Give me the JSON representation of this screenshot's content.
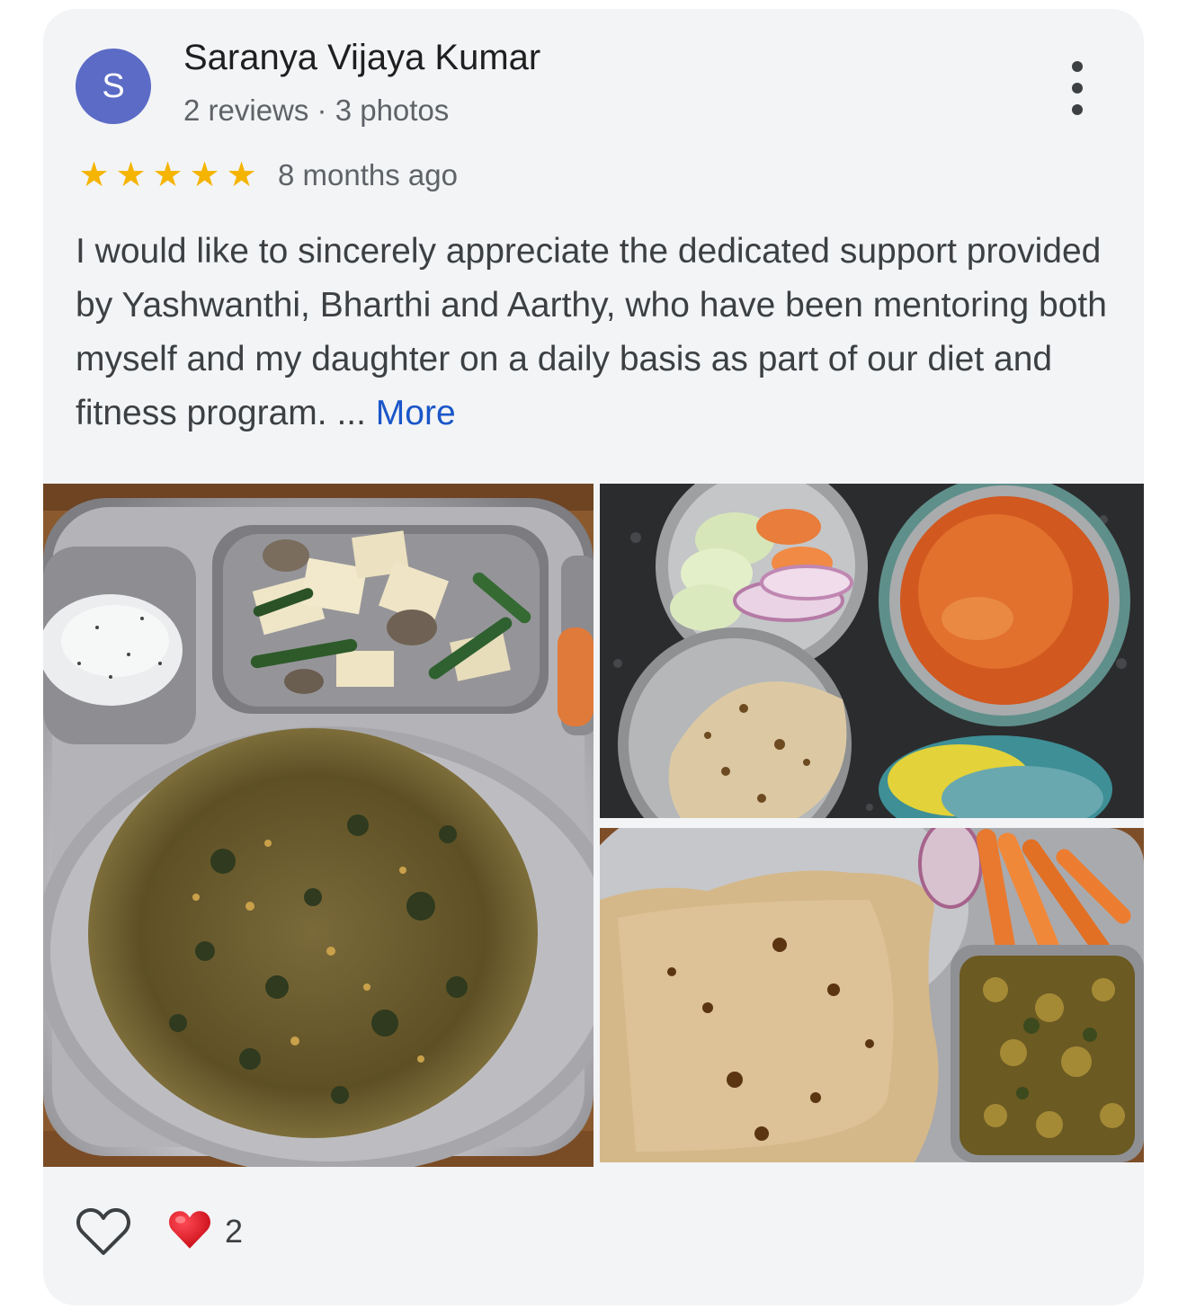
{
  "reviewer": {
    "initial": "S",
    "name": "Saranya Vijaya Kumar",
    "meta": "2 reviews · 3 photos",
    "avatar_color": "#5b6bc6"
  },
  "review": {
    "rating": 5,
    "rating_max": 5,
    "stars": "★★★★★",
    "time_ago": "8 months ago",
    "text": "I would like to sincerely appreciate the dedicated support provided by Yashwanthi, Bharthi and Aarthy, who have been mentoring both myself and my daughter on a daily basis as part of our diet and fitness program. ...",
    "more_label": "More"
  },
  "photos": [
    {
      "subject": "steel plate with curd, paneer stir-fry and vegetable adai"
    },
    {
      "subject": "steel containers with cucumber, carrot, onion, dal and chapati"
    },
    {
      "subject": "chapati with carrot sticks, onion and vegetable curry"
    }
  ],
  "reactions": {
    "like_icon": "heart-outline-icon",
    "reaction_icon": "red-heart-icon",
    "count": "2"
  },
  "colors": {
    "card_bg": "#f3f4f6",
    "star": "#f5b400",
    "link": "#1a56c8",
    "heart": "#e0141e"
  }
}
